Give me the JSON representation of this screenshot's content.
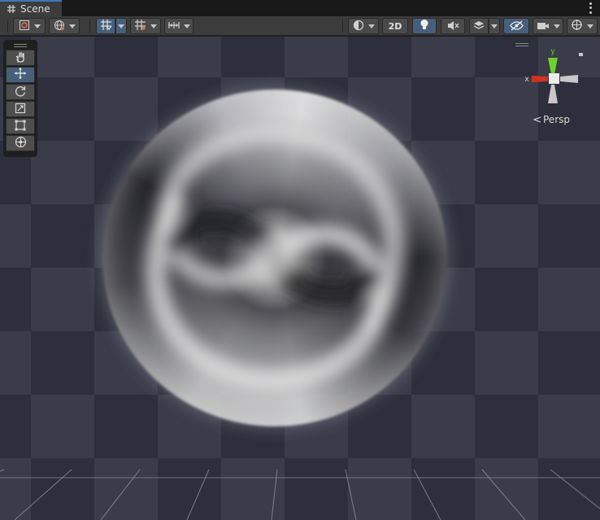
{
  "window": {
    "tab_label": "Scene",
    "tab_icon": "grid-icon",
    "menu_icon": "kebab-menu-icon"
  },
  "toolbar": {
    "left_buttons": [
      {
        "name": "draw-mode-dropdown",
        "icon": "draw-mode-icon"
      },
      {
        "name": "global-local-dropdown",
        "icon": "globe-icon"
      },
      {
        "name": "grid-snap-toggle",
        "icon": "grid-snap-icon",
        "active": true
      },
      {
        "name": "increment-snap-dropdown",
        "icon": "increment-snap-icon"
      },
      {
        "name": "ruler-dropdown",
        "icon": "ruler-icon"
      }
    ],
    "right_buttons": [
      {
        "name": "shading-dropdown",
        "icon": "sphere-shading-icon"
      },
      {
        "name": "toggle-2d-button",
        "label": "2D"
      },
      {
        "name": "lighting-toggle",
        "icon": "lightbulb-icon",
        "active": true
      },
      {
        "name": "audio-toggle",
        "icon": "mute-speaker-icon"
      },
      {
        "name": "effects-dropdown",
        "icon": "layers-icon"
      },
      {
        "name": "scene-visibility-toggle",
        "icon": "eye-hidden-icon",
        "active": true
      },
      {
        "name": "camera-dropdown",
        "icon": "camera-icon"
      },
      {
        "name": "gizmos-dropdown",
        "icon": "gizmo-icon"
      }
    ],
    "label_2d": "2D"
  },
  "tools": [
    {
      "name": "hand-tool",
      "icon": "hand-icon"
    },
    {
      "name": "move-tool",
      "icon": "move-arrows-icon",
      "active": true
    },
    {
      "name": "rotate-tool",
      "icon": "rotate-icon"
    },
    {
      "name": "scale-tool",
      "icon": "scale-icon"
    },
    {
      "name": "rect-tool",
      "icon": "rect-icon"
    },
    {
      "name": "transform-tool",
      "icon": "transform-icon"
    }
  ],
  "gizmo": {
    "axis_x": "x",
    "axis_y": "y",
    "projection_label": "Persp",
    "colors": {
      "x": "#d2321e",
      "y": "#6fd12b",
      "neutral": "#d9d9d9"
    }
  },
  "scene": {
    "object": "swirl-sphere",
    "background_colors": {
      "dark": "#2d2f3c",
      "light": "#3a3c4a"
    }
  }
}
